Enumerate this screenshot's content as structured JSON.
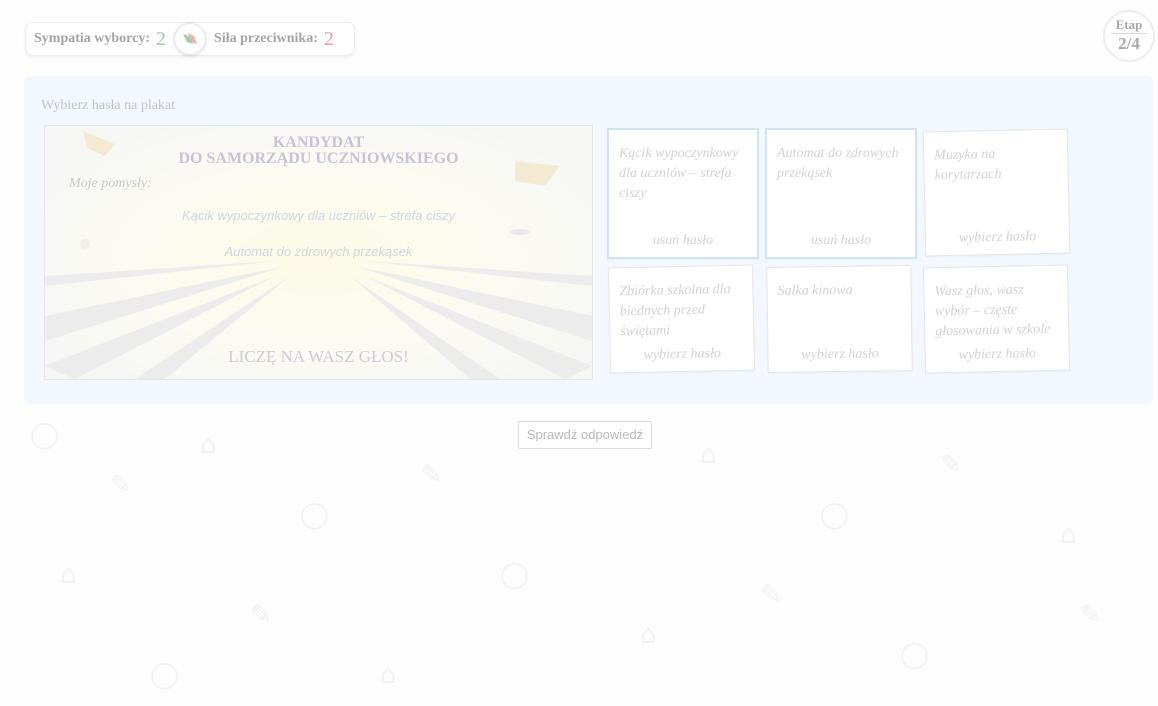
{
  "header": {
    "voter_sympathy_label": "Sympatia wyborcy:",
    "voter_sympathy_value": "2",
    "opponent_strength_label": "Siła przeciwnika:",
    "opponent_strength_value": "2",
    "stage_label": "Etap",
    "stage_value": "2/4"
  },
  "panel": {
    "instruction": "Wybierz hasła na plakat"
  },
  "poster": {
    "title_line1": "KANDYDAT",
    "title_line2": "DO SAMORZĄDU UCZNIOWSKIEGO",
    "ideas_label": "Moje pomysły:",
    "ideas": [
      "Kącik wypoczynkowy dla uczniów – strefa ciszy",
      "Automat do zdrowych przekąsek"
    ],
    "footer": "LICZĘ NA WASZ GŁOS!"
  },
  "cards": [
    {
      "text": "Kącik wypoczynkowy dla uczniów – strefa ciszy",
      "action": "usuń hasło",
      "selected": true
    },
    {
      "text": "Automat do zdrowych przekąsek",
      "action": "usuń hasło",
      "selected": true
    },
    {
      "text": "Muzyka na korytarzach",
      "action": "wybierz hasło",
      "selected": false
    },
    {
      "text": "Zbiórka szkolna dla biednych przed świętami",
      "action": "wybierz hasło",
      "selected": false
    },
    {
      "text": "Salka kinowa",
      "action": "wybierz hasło",
      "selected": false
    },
    {
      "text": "Wasz głos, wasz wybór – częste głosowania w szkole",
      "action": "wybierz hasło",
      "selected": false
    }
  ],
  "check_button": "Sprawdź odpowiedź",
  "colors": {
    "sympathy": "#8ed3a4",
    "opponent": "#ef9b9b",
    "panel_bg": "#f2f8fd",
    "selected_border": "#cfe4f3"
  }
}
